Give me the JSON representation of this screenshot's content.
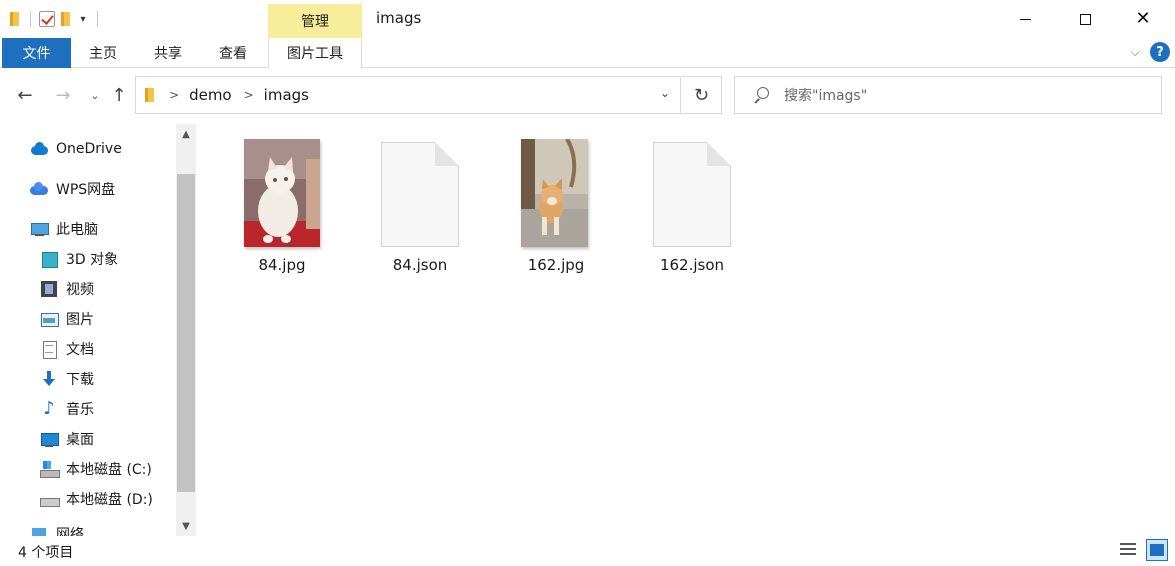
{
  "titlebar": {
    "window_title": "imags",
    "contextual_tab_group": "管理",
    "icons": [
      "folder-icon",
      "properties-check-icon",
      "new-folder-icon",
      "customize-dropdown-icon"
    ]
  },
  "window_controls": {
    "minimize": "minimize-icon",
    "maximize": "maximize-icon",
    "close": "✕"
  },
  "ribbon": {
    "tabs": [
      {
        "label": "文件"
      },
      {
        "label": "主页"
      },
      {
        "label": "共享"
      },
      {
        "label": "查看"
      },
      {
        "label": "图片工具"
      }
    ],
    "expand_icon": "chevron-down-icon",
    "help_label": "?"
  },
  "navigation": {
    "back": "←",
    "forward": "→",
    "recent": "⌄",
    "up": "↑",
    "breadcrumbs": [
      "demo",
      "imags"
    ],
    "refresh": "↻",
    "address_dropdown": "⌄"
  },
  "search": {
    "placeholder": "搜索\"imags\""
  },
  "sidebar": {
    "items": [
      {
        "label": "OneDrive",
        "icon": "onedrive-cloud-icon"
      },
      {
        "label": "WPS网盘",
        "icon": "wps-cloud-icon"
      },
      {
        "label": "此电脑",
        "icon": "this-pc-icon"
      },
      {
        "label": "3D 对象",
        "icon": "3d-objects-icon"
      },
      {
        "label": "视频",
        "icon": "video-icon"
      },
      {
        "label": "图片",
        "icon": "pictures-icon"
      },
      {
        "label": "文档",
        "icon": "documents-icon"
      },
      {
        "label": "下载",
        "icon": "downloads-icon"
      },
      {
        "label": "音乐",
        "icon": "music-icon"
      },
      {
        "label": "桌面",
        "icon": "desktop-icon"
      },
      {
        "label": "本地磁盘 (C:)",
        "icon": "drive-c-icon"
      },
      {
        "label": "本地磁盘 (D:)",
        "icon": "drive-d-icon"
      },
      {
        "label": "网络",
        "icon": "network-icon"
      }
    ],
    "scroll_up": "▲",
    "scroll_down": "▼"
  },
  "files": [
    {
      "name": "84.jpg",
      "kind": "image"
    },
    {
      "name": "84.json",
      "kind": "document"
    },
    {
      "name": "162.jpg",
      "kind": "image"
    },
    {
      "name": "162.json",
      "kind": "document"
    }
  ],
  "statusbar": {
    "item_count": "4 个项目",
    "view_icons": [
      "details-view-icon",
      "large-icons-view-icon"
    ]
  },
  "colors": {
    "accent": "#1e6fc0",
    "contextual_tab": "#f8ed9a",
    "scroll_track": "#f0f0f0",
    "scroll_thumb": "#c2c2c2"
  }
}
